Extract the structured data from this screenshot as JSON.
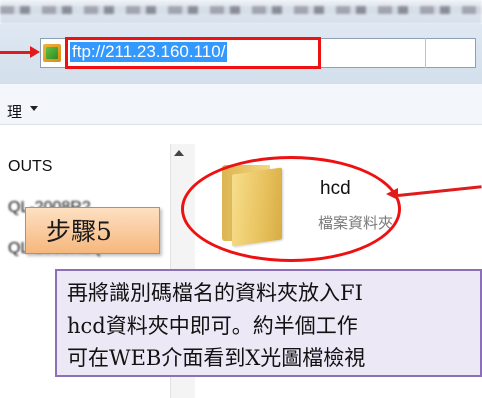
{
  "address_bar": {
    "url": "ftp://211.23.160.110/"
  },
  "toolbar": {
    "organize_label": "理",
    "organize_icon": "chevron-down-icon"
  },
  "nav_pane": {
    "items": [
      "OUTS",
      "QL-2008R2",
      "QL-2008R2 ("
    ]
  },
  "content": {
    "folder": {
      "name": "hcd",
      "type": "檔案資料夾",
      "icon": "folder-icon"
    }
  },
  "annotations": {
    "step_label": "步驟5",
    "instruction_lines": [
      "再將識別碼檔名的資料夾放入FI",
      "hcd資料夾中即可。約半個工作",
      "可在WEB介面看到X光圖檔檢視"
    ],
    "highlight_color": "#e11111"
  }
}
